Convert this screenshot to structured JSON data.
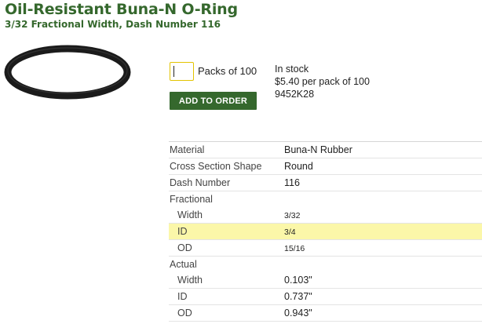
{
  "header": {
    "title": "Oil-Resistant Buna-N O-Ring",
    "subtitle": "3/32 Fractional Width, Dash Number 116"
  },
  "order": {
    "quantity_value": "",
    "pack_label": "Packs of 100",
    "stock_status": "In stock",
    "price": "$5.40 per pack of 100",
    "part_number": "9452K28",
    "add_button_label": "ADD TO ORDER"
  },
  "specs": {
    "material": {
      "label": "Material",
      "value": "Buna-N Rubber"
    },
    "cross_section": {
      "label": "Cross Section Shape",
      "value": "Round"
    },
    "dash_number": {
      "label": "Dash Number",
      "value": "116"
    },
    "fractional": {
      "label": "Fractional",
      "width": {
        "label": "Width",
        "value": "3/32"
      },
      "id": {
        "label": "ID",
        "value": "3/4"
      },
      "od": {
        "label": "OD",
        "value": "15/16"
      }
    },
    "actual": {
      "label": "Actual",
      "width": {
        "label": "Width",
        "value": "0.103\""
      },
      "id": {
        "label": "ID",
        "value": "0.737\""
      },
      "od": {
        "label": "OD",
        "value": "0.943\""
      }
    }
  },
  "colors": {
    "brand_green": "#35682d",
    "highlight_row": "#fbf7a9",
    "input_border": "#e3c400"
  },
  "icons": [
    "o-ring-product-image"
  ]
}
